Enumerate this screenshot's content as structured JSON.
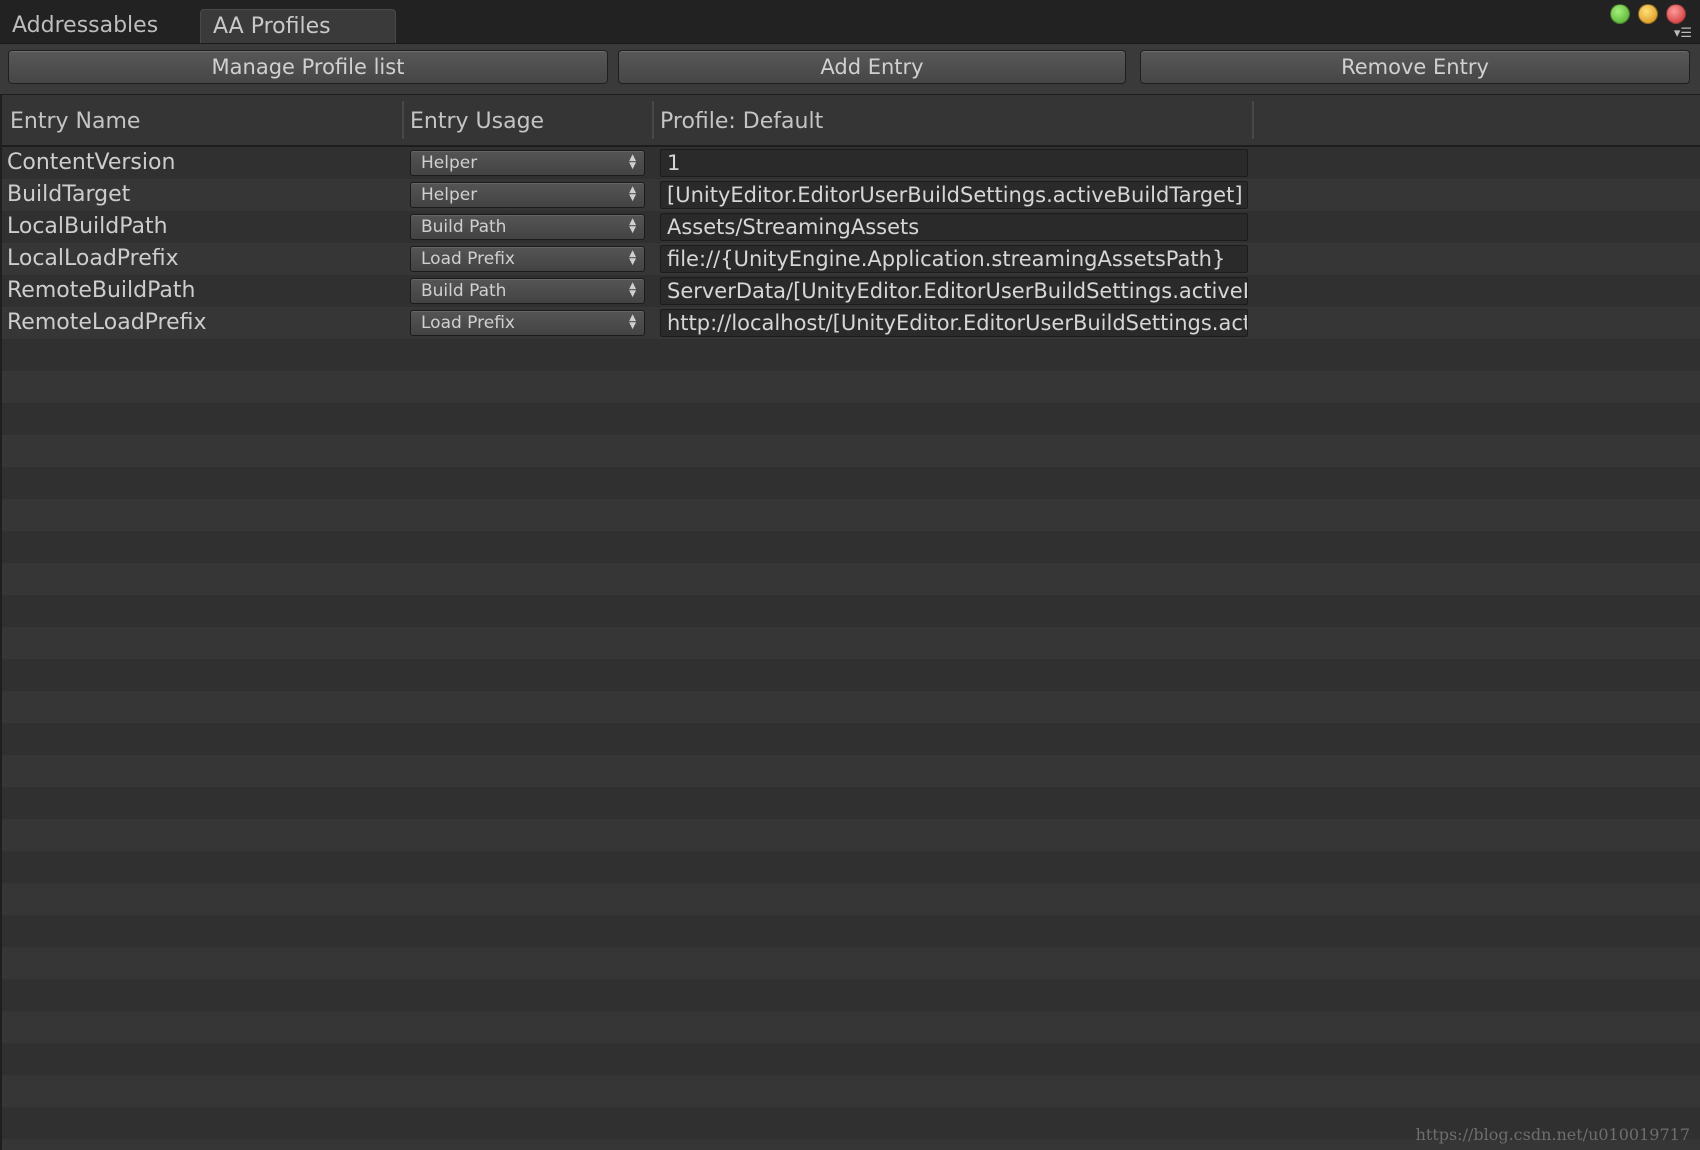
{
  "tabs": [
    {
      "label": "Addressables"
    },
    {
      "label": "AA Profiles"
    }
  ],
  "window_controls": [
    {
      "name": "maximize",
      "color": "#5fbf3a"
    },
    {
      "name": "minimize",
      "color": "#e0a020"
    },
    {
      "name": "close",
      "color": "#e04040"
    }
  ],
  "toolbar": {
    "manage_label": "Manage Profile list",
    "add_label": "Add Entry",
    "remove_label": "Remove Entry"
  },
  "table": {
    "columns": [
      "Entry Name",
      "Entry Usage",
      "Profile: Default"
    ],
    "rows": [
      {
        "name": "ContentVersion",
        "usage": "Helper",
        "value": "1"
      },
      {
        "name": "BuildTarget",
        "usage": "Helper",
        "value": "[UnityEditor.EditorUserBuildSettings.activeBuildTarget]"
      },
      {
        "name": "LocalBuildPath",
        "usage": "Build Path",
        "value": "Assets/StreamingAssets"
      },
      {
        "name": "LocalLoadPrefix",
        "usage": "Load Prefix",
        "value": "file://{UnityEngine.Application.streamingAssetsPath}"
      },
      {
        "name": "RemoteBuildPath",
        "usage": "Build Path",
        "value": "ServerData/[UnityEditor.EditorUserBuildSettings.activeBuildTarget]"
      },
      {
        "name": "RemoteLoadPrefix",
        "usage": "Load Prefix",
        "value": "http://localhost/[UnityEditor.EditorUserBuildSettings.activeBuildTarget]"
      }
    ]
  },
  "watermark": "https://blog.csdn.net/u010019717"
}
